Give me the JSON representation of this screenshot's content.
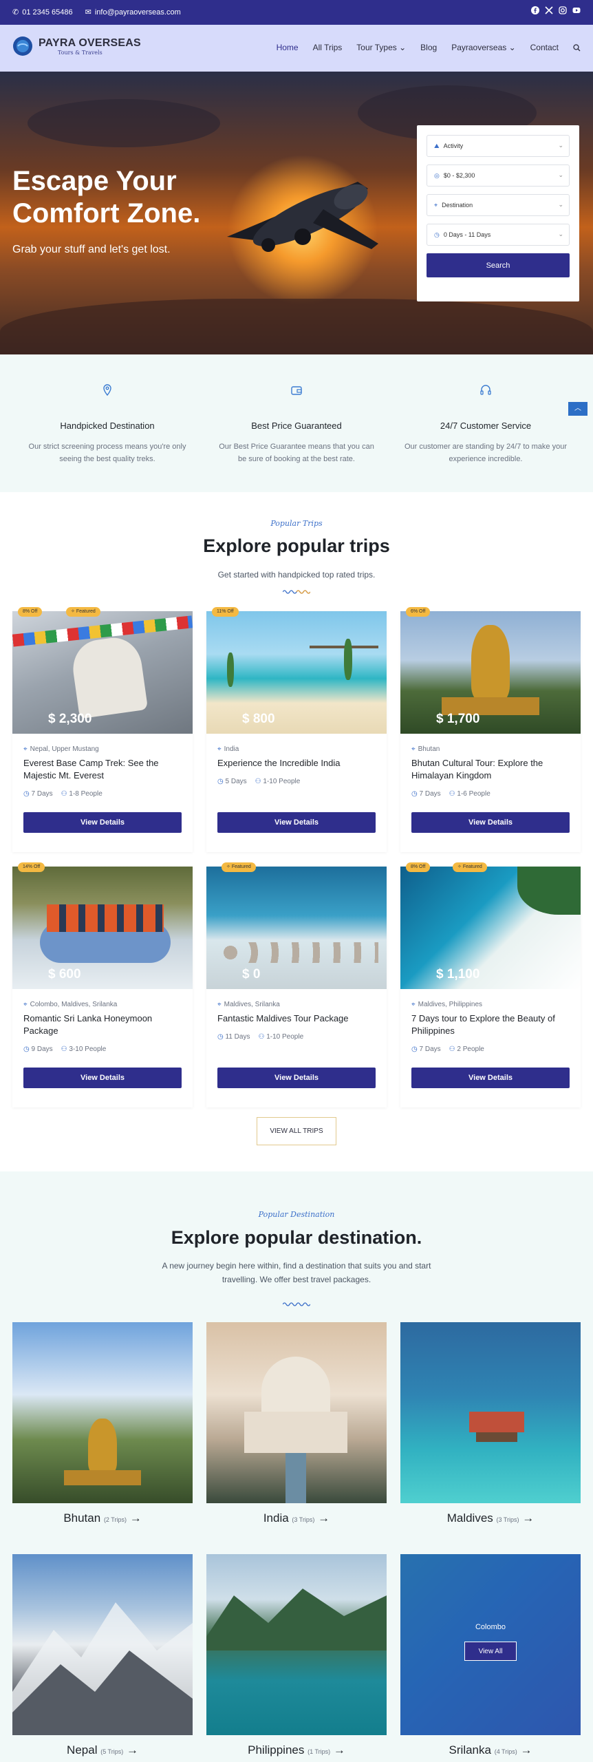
{
  "topbar": {
    "phone": "01 2345 65486",
    "email": "info@payraoverseas.com",
    "socials": [
      "facebook-icon",
      "x-icon",
      "instagram-icon",
      "youtube-icon"
    ]
  },
  "brand": {
    "name": "PAYRA OVERSEAS",
    "tagline": "Tours & Travels"
  },
  "nav": {
    "items": [
      {
        "label": "Home",
        "active": true
      },
      {
        "label": "All Trips"
      },
      {
        "label": "Tour Types ⌄"
      },
      {
        "label": "Blog"
      },
      {
        "label": "Payraoverseas ⌄"
      },
      {
        "label": "Contact"
      }
    ]
  },
  "hero": {
    "title": "Escape Your Comfort Zone.",
    "subtitle": "Grab your stuff and let's get lost."
  },
  "search": {
    "activity": "Activity",
    "budget": "$0 - $2,300",
    "destination": "Destination",
    "duration": "0 Days - 11 Days",
    "button": "Search"
  },
  "features": [
    {
      "title": "Handpicked Destination",
      "text": "Our strict screening process means you're only seeing the best quality treks."
    },
    {
      "title": "Best Price Guaranteed",
      "text": "Our Best Price Guarantee means that you can be sure of booking at the best rate."
    },
    {
      "title": "24/7 Customer Service",
      "text": "Our customer are standing by 24/7 to make your experience incredible."
    }
  ],
  "popular": {
    "kicker": "Popular Trips",
    "title": "Explore popular trips",
    "desc": "Get started with handpicked top rated trips.",
    "view_all": "VIEW ALL TRIPS"
  },
  "trips": [
    {
      "off": "8% Off",
      "featured": "Featured",
      "price": "$ 2,300",
      "location": "Nepal, Upper Mustang",
      "title": "Everest Base Camp Trek: See the Majestic Mt. Everest",
      "days": "7 Days",
      "people": "1-8 People",
      "button": "View Details"
    },
    {
      "off": "11% Off",
      "featured": "",
      "price": "$ 800",
      "location": "India",
      "title": "Experience the Incredible India",
      "days": "5 Days",
      "people": "1-10 People",
      "button": "View Details"
    },
    {
      "off": "6% Off",
      "featured": "",
      "price": "$ 1,700",
      "location": "Bhutan",
      "title": "Bhutan Cultural Tour: Explore the Himalayan Kingdom",
      "days": "7 Days",
      "people": "1-6 People",
      "button": "View Details"
    },
    {
      "off": "14% Off",
      "featured": "",
      "price": "$ 600",
      "location": "Colombo, Maldives, Srilanka",
      "title": "Romantic Sri Lanka Honeymoon Package",
      "days": "9 Days",
      "people": "3-10 People",
      "button": "View Details"
    },
    {
      "off": "",
      "featured": "Featured",
      "price": "$ 0",
      "location": "Maldives, Srilanka",
      "title": "Fantastic Maldives Tour Package",
      "days": "11 Days",
      "people": "1-10 People",
      "button": "View Details"
    },
    {
      "off": "8% Off",
      "featured": "Featured",
      "price": "$ 1,100",
      "location": "Maldives, Philippines",
      "title": "7 Days tour to Explore the Beauty of Philippines",
      "days": "7 Days",
      "people": "2 People",
      "button": "View Details"
    }
  ],
  "destinations_section": {
    "kicker": "Popular Destination",
    "title": "Explore popular destination.",
    "desc": "A new journey begin here within, find a destination that suits you and start travelling. We offer best travel packages."
  },
  "destinations": [
    {
      "name": "Bhutan",
      "count": "(2 Trips)"
    },
    {
      "name": "India",
      "count": "(3 Trips)"
    },
    {
      "name": "Maldives",
      "count": "(3 Trips)"
    },
    {
      "name": "Nepal",
      "count": "(5 Trips)"
    },
    {
      "name": "Philippines",
      "count": "(1 Trips)"
    },
    {
      "name": "Srilanka",
      "count": "(4 Trips)",
      "overlay_label": "Colombo",
      "overlay_button": "View All"
    }
  ]
}
